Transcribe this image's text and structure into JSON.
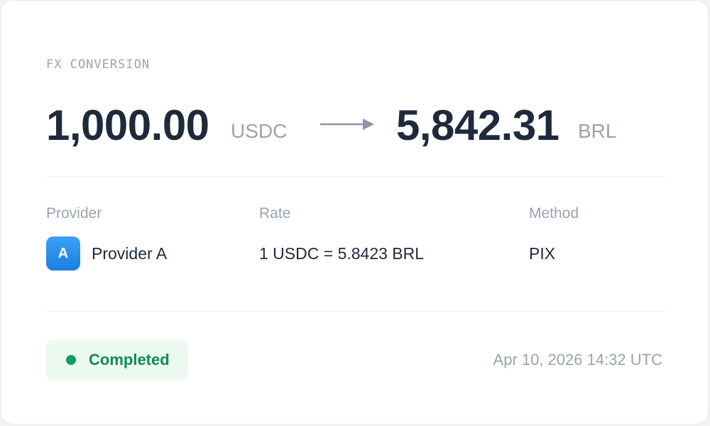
{
  "card": {
    "label": "FX CONVERSION",
    "from": {
      "amount": "1,000.00",
      "currency": "USDC"
    },
    "to": {
      "amount": "5,842.31",
      "currency": "BRL"
    },
    "arrow_icon": "arrow-right-icon"
  },
  "details": {
    "provider": {
      "header": "Provider",
      "avatar_letter": "A",
      "name": "Provider A"
    },
    "rate": {
      "header": "Rate",
      "value": "1 USDC = 5.8423 BRL"
    },
    "method": {
      "header": "Method",
      "value": "PIX"
    }
  },
  "footer": {
    "status": "Completed",
    "timestamp": "Apr 10, 2026 14:32 UTC"
  },
  "colors": {
    "text_primary": "#1e2a3c",
    "text_muted": "#9aa3af",
    "success": "#0f9d63",
    "success_bg": "#ecf9f1",
    "provider_accent": "#1a7fe0"
  }
}
